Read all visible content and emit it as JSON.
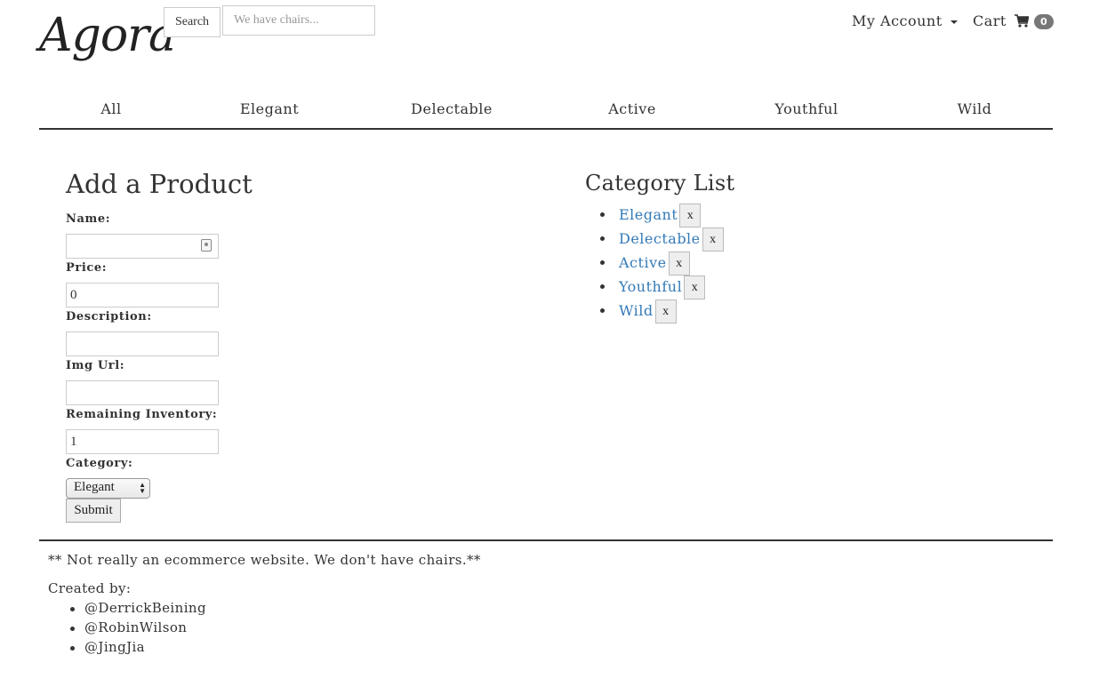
{
  "brand": {
    "logo": "Agora"
  },
  "search": {
    "button_label": "Search",
    "placeholder": "We have chairs..."
  },
  "account": {
    "label": "My Account"
  },
  "cart": {
    "label": "Cart",
    "count": "0"
  },
  "nav": {
    "items": [
      "All",
      "Elegant",
      "Delectable",
      "Active",
      "Youthful",
      "Wild"
    ]
  },
  "product_form": {
    "title": "Add a Product",
    "name_label": "Name:",
    "name_value": "",
    "price_label": "Price:",
    "price_value": "0",
    "description_label": "Description:",
    "description_value": "",
    "img_url_label": "Img Url:",
    "img_url_value": "",
    "inventory_label": "Remaining Inventory:",
    "inventory_value": "1",
    "category_label": "Category:",
    "category_selected": "Elegant",
    "submit_label": "Submit"
  },
  "category_list": {
    "title": "Category List",
    "items": [
      "Elegant",
      "Delectable",
      "Active",
      "Youthful",
      "Wild"
    ],
    "delete_label": "x"
  },
  "footer": {
    "disclaimer": "** Not really an ecommerce website. We don't have chairs.**",
    "created_by_label": "Created by:",
    "authors": [
      "@DerrickBeining",
      "@RobinWilson",
      "@JingJia"
    ]
  }
}
